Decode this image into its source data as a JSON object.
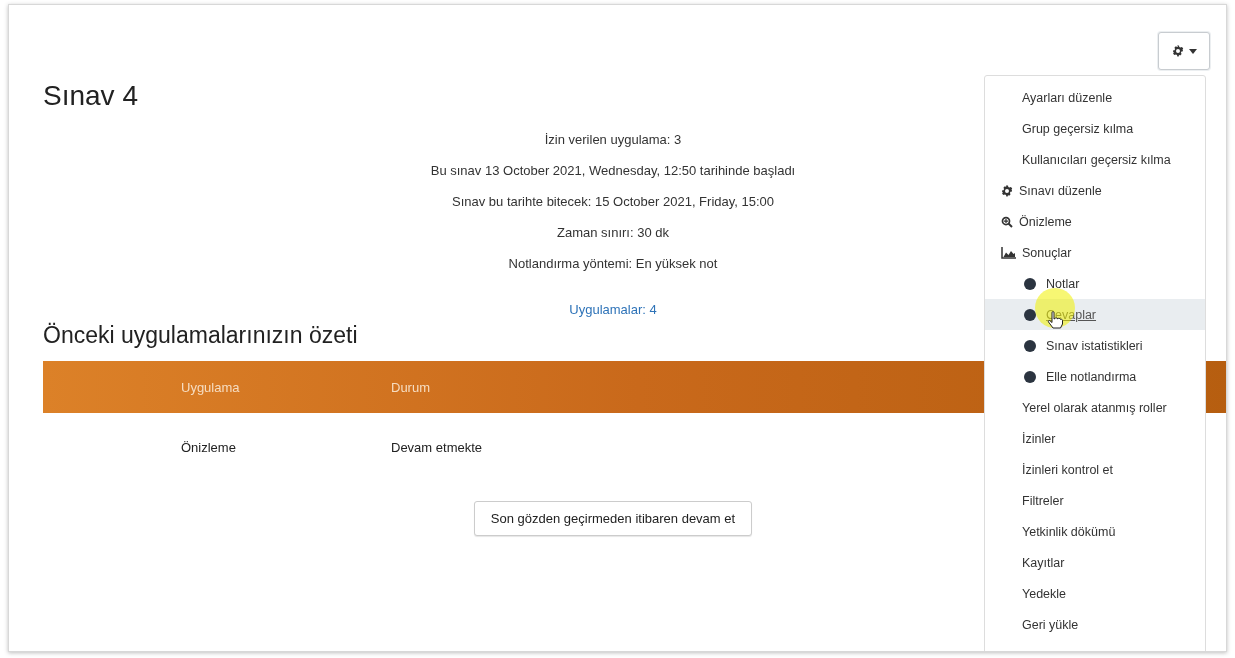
{
  "page": {
    "title": "Sınav 4"
  },
  "quiz_info": [
    "İzin verilen uygulama: 3",
    "Bu sınav 13 October 2021, Wednesday, 12:50 tarihinde başladı",
    "Sınav bu tarihte bitecek: 15 October 2021, Friday, 15:00",
    "Zaman sınırı: 30 dk",
    "Notlandırma yöntemi: En yüksek not"
  ],
  "attempts_link": "Uygulamalar: 4",
  "summary": {
    "heading": "Önceki uygulamalarınızın özeti",
    "columns": [
      "Uygulama",
      "Durum"
    ],
    "rows": [
      [
        "Önizleme",
        "Devam etmekte"
      ]
    ]
  },
  "continue_button": "Son gözden geçirmeden itibaren devam et",
  "actions_menu": {
    "expanded": true,
    "items": [
      {
        "label": "Ayarları düzenle",
        "kind": "text",
        "selected": false
      },
      {
        "label": "Grup geçersiz kılma",
        "kind": "text",
        "selected": false
      },
      {
        "label": "Kullanıcıları geçersiz kılma",
        "kind": "text",
        "selected": false
      },
      {
        "label": "Sınavı düzenle",
        "kind": "gear",
        "selected": false
      },
      {
        "label": "Önizleme",
        "kind": "zoom",
        "selected": false
      },
      {
        "label": "Sonuçlar",
        "kind": "chart",
        "selected": false
      },
      {
        "label": "Notlar",
        "kind": "bullet",
        "selected": false
      },
      {
        "label": "Cevaplar",
        "kind": "bullet",
        "selected": true
      },
      {
        "label": "Sınav istatistikleri",
        "kind": "bullet",
        "selected": false
      },
      {
        "label": "Elle notlandırma",
        "kind": "bullet",
        "selected": false
      },
      {
        "label": "Yerel olarak atanmış roller",
        "kind": "text",
        "selected": false
      },
      {
        "label": "İzinler",
        "kind": "text",
        "selected": false
      },
      {
        "label": "İzinleri kontrol et",
        "kind": "text",
        "selected": false
      },
      {
        "label": "Filtreler",
        "kind": "text",
        "selected": false
      },
      {
        "label": "Yetkinlik dökümü",
        "kind": "text",
        "selected": false
      },
      {
        "label": "Kayıtlar",
        "kind": "text",
        "selected": false
      },
      {
        "label": "Yedekle",
        "kind": "text",
        "selected": false
      },
      {
        "label": "Geri yükle",
        "kind": "text",
        "selected": false
      }
    ]
  }
}
